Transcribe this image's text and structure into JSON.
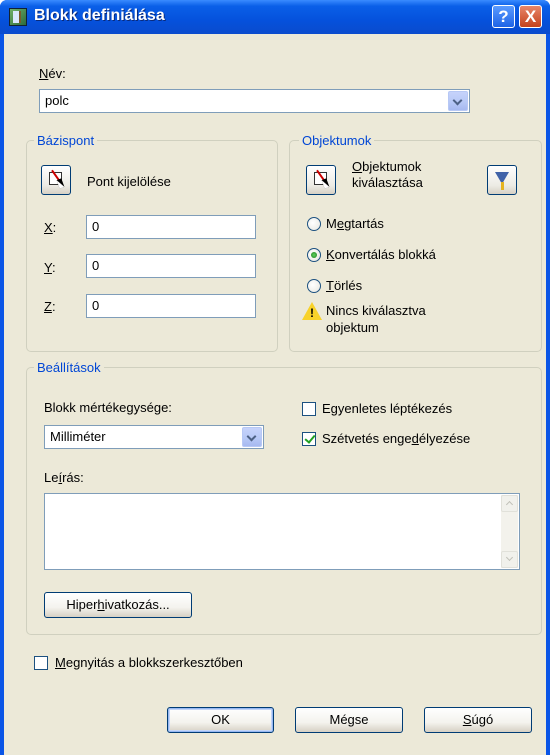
{
  "window": {
    "title": "Blokk definiálása",
    "help_glyph": "?",
    "close_glyph": "X"
  },
  "name": {
    "label_u": "N",
    "label_rest": "év:",
    "value": "polc"
  },
  "base_point": {
    "group_title": "Bázispont",
    "pick_label": "Pont kijelölése",
    "x_label_u": "X",
    "x_label_rest": ":",
    "x_value": "0",
    "y_label_u": "Y",
    "y_label_rest": ":",
    "y_value": "0",
    "z_label_u": "Z",
    "z_label_rest": ":",
    "z_value": "0"
  },
  "objects": {
    "group_title": "Objektumok",
    "select_line1_u": "O",
    "select_line1_rest": "bjektumok",
    "select_line2": "kiválasztása",
    "retain_pre": "M",
    "retain_u": "e",
    "retain_rest": "gtartás",
    "convert_u": "K",
    "convert_rest": "onvertálás blokká",
    "delete_u": "T",
    "delete_rest": "örlés",
    "warning_line1": "Nincs kiválasztva",
    "warning_line2": "objektum",
    "warning_glyph": "!",
    "selected_option": "Konvertálás blokká"
  },
  "settings": {
    "group_title": "Beállítások",
    "units_pre": "Blokk mértéke",
    "units_u": "g",
    "units_rest": "ysége:",
    "units_value": "Milliméter",
    "scale_pre": "E",
    "scale_u": "g",
    "scale_rest": "yenletes léptékezés",
    "scale_checked": false,
    "explode_pre": "Szétvetés enge",
    "explode_u": "d",
    "explode_rest": "élyezése",
    "explode_checked": true,
    "desc_pre": "Le",
    "desc_u": "í",
    "desc_rest": "rás:",
    "desc_value": "",
    "hyperlink_pre": "Hiper",
    "hyperlink_u": "h",
    "hyperlink_rest": "ivatkozás..."
  },
  "open_editor": {
    "label_u": "M",
    "label_rest": "egnyitás a blokkszerkesztőben",
    "checked": false
  },
  "buttons": {
    "ok": "OK",
    "cancel": "Mégse",
    "help_u": "S",
    "help_rest": "úgó"
  }
}
